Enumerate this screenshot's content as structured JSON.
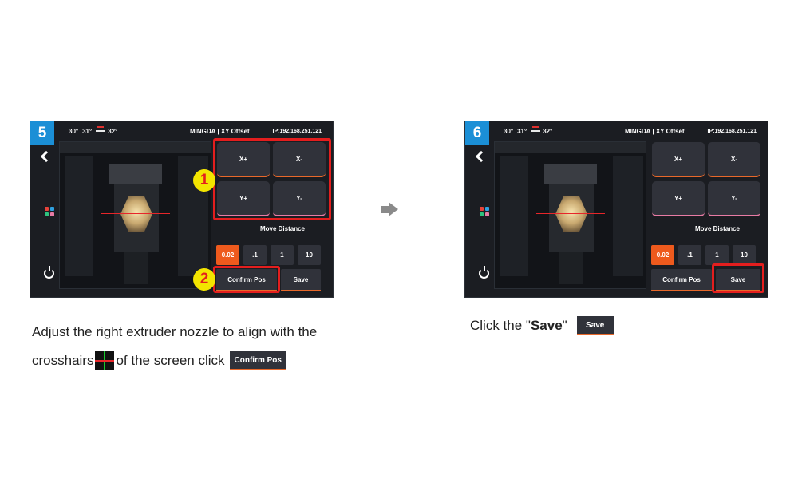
{
  "colors": {
    "accent": "#ee5a1d",
    "highlight": "#e41e1e",
    "badge": "#1b8fd6",
    "marker": "#f3e500"
  },
  "statusbar": {
    "nozzle1_temp": "30°",
    "nozzle2_temp": "31°",
    "bed_temp": "32°",
    "title": "MINGDA | XY Offset",
    "ip": "IP:192.168.251.121"
  },
  "jog": {
    "x_plus": "X+",
    "x_minus": "X-",
    "y_plus": "Y+",
    "y_minus": "Y-"
  },
  "move_distance_label": "Move Distance",
  "distances": [
    "0.02",
    ".1",
    "1",
    "10"
  ],
  "active_distance": "0.02",
  "actions": {
    "confirm_pos": "Confirm Pos",
    "save": "Save"
  },
  "step5": {
    "number": "5",
    "marker1": "1",
    "marker2": "2",
    "line1": "Adjust the right extruder nozzle to align with the",
    "line2a": "crosshairs",
    "line2b": "of the screen click",
    "inline_button": "Confirm Pos"
  },
  "step6": {
    "number": "6",
    "prefix": "Click the \"",
    "bold": "Save",
    "suffix": "\"",
    "inline_button": "Save"
  },
  "icons": [
    "nozzle-icon",
    "bed-icon",
    "back-icon",
    "apps-icon",
    "power-icon",
    "arrow-right-icon"
  ]
}
